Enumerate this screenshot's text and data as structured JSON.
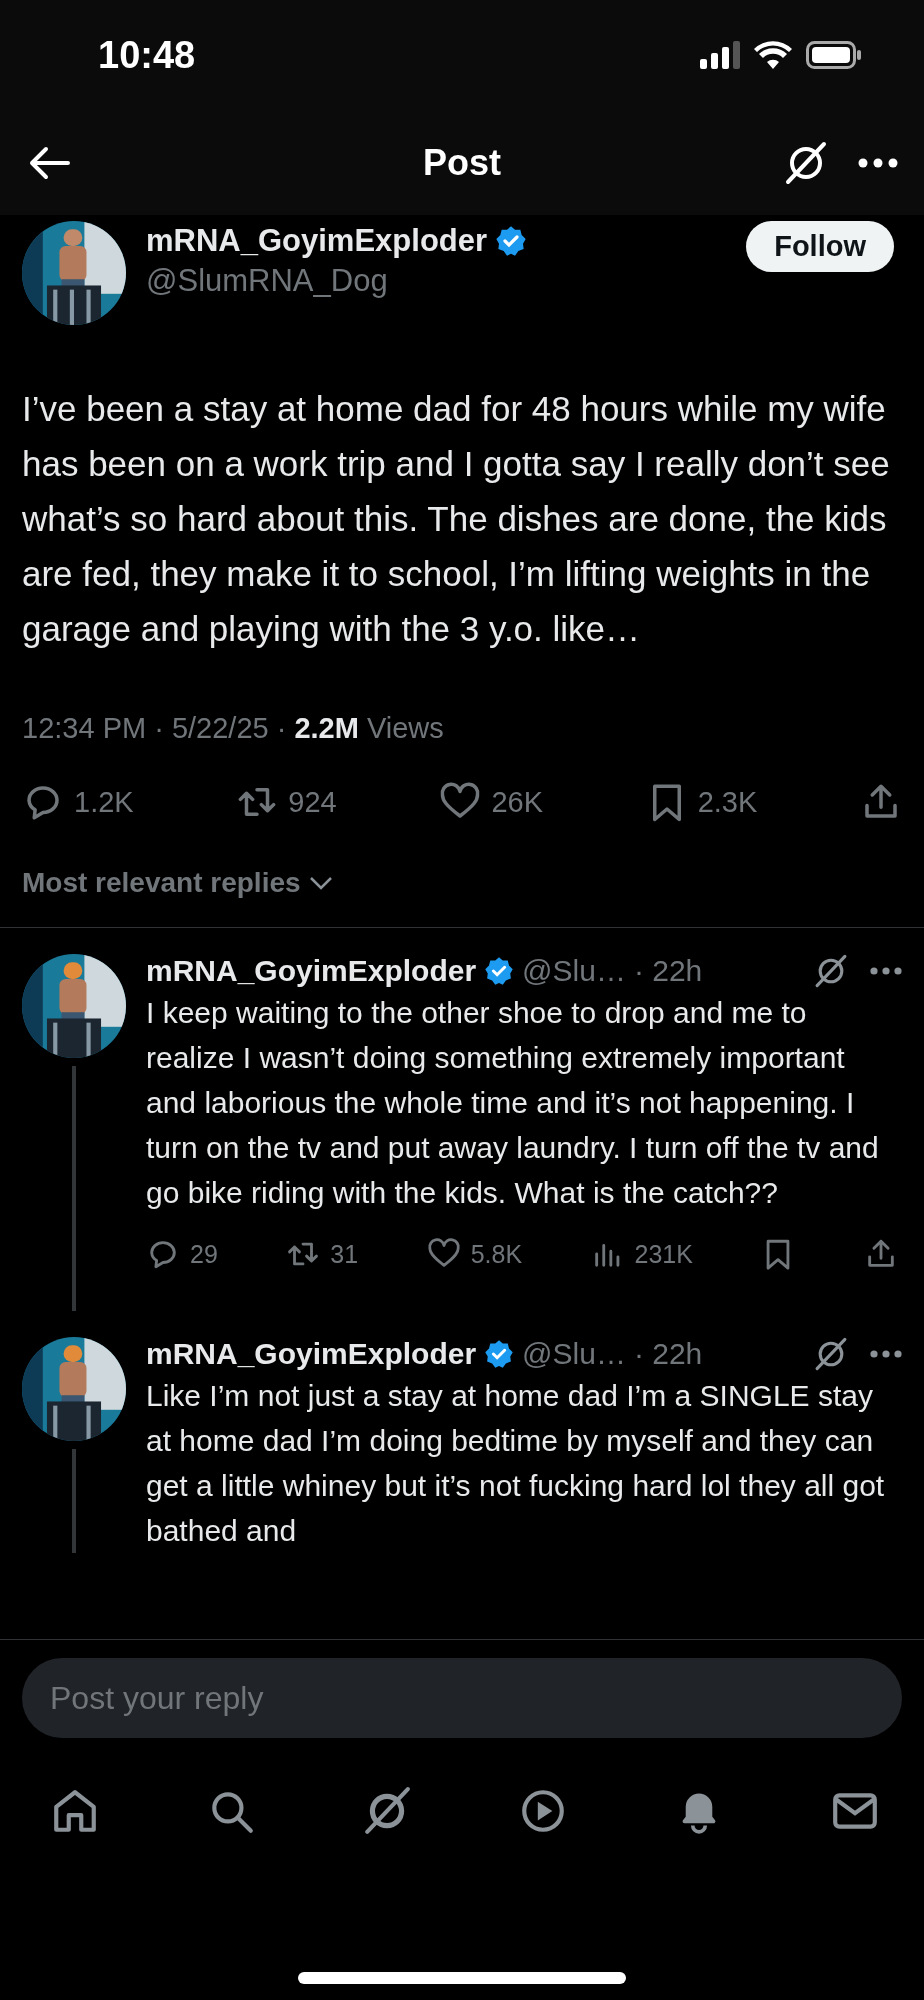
{
  "status_bar": {
    "time": "10:48"
  },
  "header": {
    "title": "Post"
  },
  "post": {
    "author": {
      "name": "mRNA_GoyimExploder",
      "verified": true,
      "handle": "@SlumRNA_Dog"
    },
    "follow_button": "Follow",
    "text": "I’ve been a stay at home dad for 48 hours while my wife has been on a work trip and I gotta say I really don’t see what’s so hard about this. The dishes are done, the kids are fed, they make it to school, I’m lifting weights in the garage and playing with the 3 y.o. like…",
    "meta": "12:34 PM · 5/22/25 · **2.2M** Views",
    "actions": [
      {
        "kind": "reply",
        "count": "1.2K"
      },
      {
        "kind": "repost",
        "count": "924"
      },
      {
        "kind": "like",
        "count": "26K"
      },
      {
        "kind": "bookmark",
        "count": "2.3K"
      },
      {
        "kind": "share"
      }
    ]
  },
  "replies_sort": "Most relevant replies",
  "replies": [
    {
      "name": "mRNA_GoyimExploder",
      "verified": true,
      "handle": "@Slu…",
      "time": "· 22h",
      "text": "I keep waiting to the other shoe to drop and me to realize I wasn’t doing something extremely important and laborious the whole time and it’s not happening. I turn on the tv and put away laundry. I turn off the tv and go bike riding with the kids. What is the catch??",
      "actions": [
        {
          "kind": "reply",
          "count": "29"
        },
        {
          "kind": "repost",
          "count": "31"
        },
        {
          "kind": "like",
          "count": "5.8K"
        },
        {
          "kind": "views",
          "count": "231K"
        },
        {
          "kind": "bookmark"
        },
        {
          "kind": "share"
        }
      ]
    },
    {
      "name": "mRNA_GoyimExploder",
      "verified": true,
      "handle": "@Slu…",
      "time": "· 22h",
      "text": "Like I’m not just a stay at home dad I’m a SINGLE stay at home dad I’m doing bedtime by myself and they can get a little whiney but it’s not fucking hard lol they all got bathed and"
    }
  ],
  "reply_field": {
    "placeholder": "Post your reply"
  },
  "tab_bar": [
    {
      "kind": "home",
      "selected": false
    },
    {
      "kind": "search",
      "selected": false
    },
    {
      "kind": "grok",
      "selected": false
    },
    {
      "kind": "video",
      "selected": false
    },
    {
      "kind": "notifications",
      "selected": true
    },
    {
      "kind": "messages",
      "selected": false
    }
  ]
}
